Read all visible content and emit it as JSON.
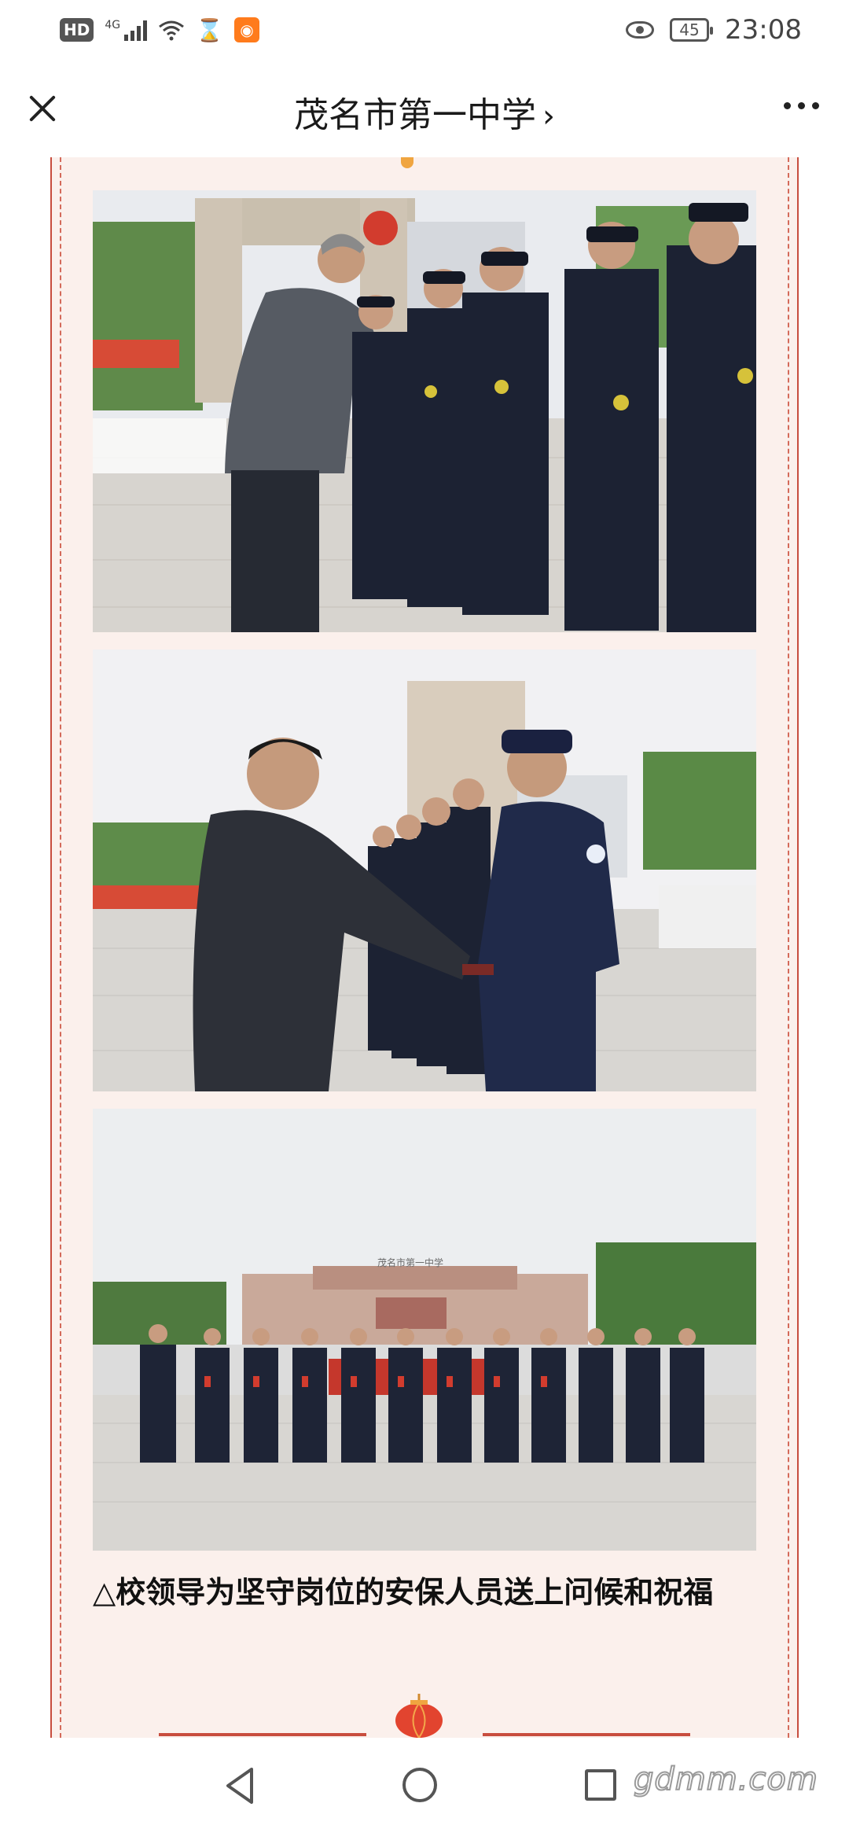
{
  "status_bar": {
    "network_type": "4G",
    "battery_level": "45",
    "time": "23:08"
  },
  "header": {
    "title": "茂名市第一中学",
    "title_chevron": "›",
    "close_icon": "close-icon",
    "more_icon": "more-icon"
  },
  "article": {
    "photos": [
      {
        "name": "handshake-photo-1"
      },
      {
        "name": "handshake-photo-2"
      },
      {
        "name": "group-photo"
      }
    ],
    "caption": "△校领导为坚守岗位的安保人员送上问候和祝福"
  },
  "nav_bar": {
    "icons": [
      "back-icon",
      "home-icon",
      "recent-apps-icon"
    ]
  },
  "watermark": "gdmm.com",
  "colors": {
    "frame_border": "#c84d3e",
    "frame_bg": "#fbf0ec",
    "uniform": "#1c2233"
  }
}
